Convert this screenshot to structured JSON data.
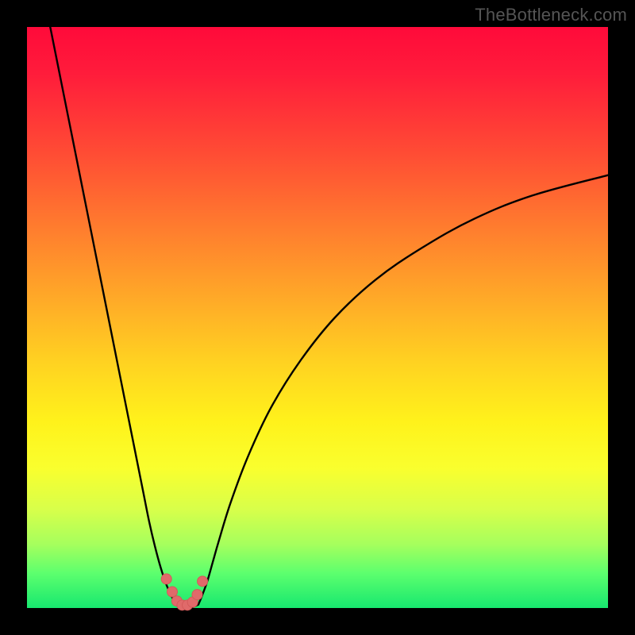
{
  "watermark": "TheBottleneck.com",
  "colors": {
    "page_bg": "#000000",
    "curve_stroke": "#000000",
    "marker_fill": "#e06a6a",
    "marker_stroke": "#d45a5a"
  },
  "chart_data": {
    "type": "line",
    "title": "",
    "xlabel": "",
    "ylabel": "",
    "xlim": [
      0,
      100
    ],
    "ylim": [
      0,
      100
    ],
    "grid": false,
    "series": [
      {
        "name": "left-branch",
        "x": [
          4.0,
          6.0,
          8.0,
          10.0,
          12.0,
          14.0,
          16.0,
          18.0,
          20.0,
          21.0,
          22.0,
          23.0,
          24.0,
          25.0,
          25.6
        ],
        "y": [
          100.0,
          90.0,
          80.0,
          70.0,
          60.0,
          50.0,
          40.0,
          30.0,
          20.0,
          15.0,
          10.7,
          7.0,
          4.0,
          1.8,
          0.6
        ]
      },
      {
        "name": "right-branch",
        "x": [
          29.5,
          30.0,
          31.0,
          32.0,
          33.0,
          35.0,
          38.0,
          42.0,
          47.0,
          53.0,
          60.0,
          68.0,
          77.0,
          87.0,
          100.0
        ],
        "y": [
          0.6,
          1.8,
          4.5,
          8.0,
          11.5,
          18.0,
          26.0,
          34.5,
          42.5,
          50.0,
          56.5,
          62.0,
          67.0,
          71.0,
          74.5
        ]
      },
      {
        "name": "valley-floor",
        "x": [
          25.6,
          26.5,
          27.5,
          28.5,
          29.5
        ],
        "y": [
          0.6,
          0.15,
          0.05,
          0.15,
          0.6
        ]
      }
    ],
    "markers": {
      "name": "valley-dots",
      "x": [
        24.0,
        25.0,
        25.8,
        26.7,
        27.6,
        28.5,
        29.3,
        30.2
      ],
      "y": [
        5.0,
        2.8,
        1.2,
        0.5,
        0.5,
        1.0,
        2.3,
        4.6
      ]
    }
  }
}
